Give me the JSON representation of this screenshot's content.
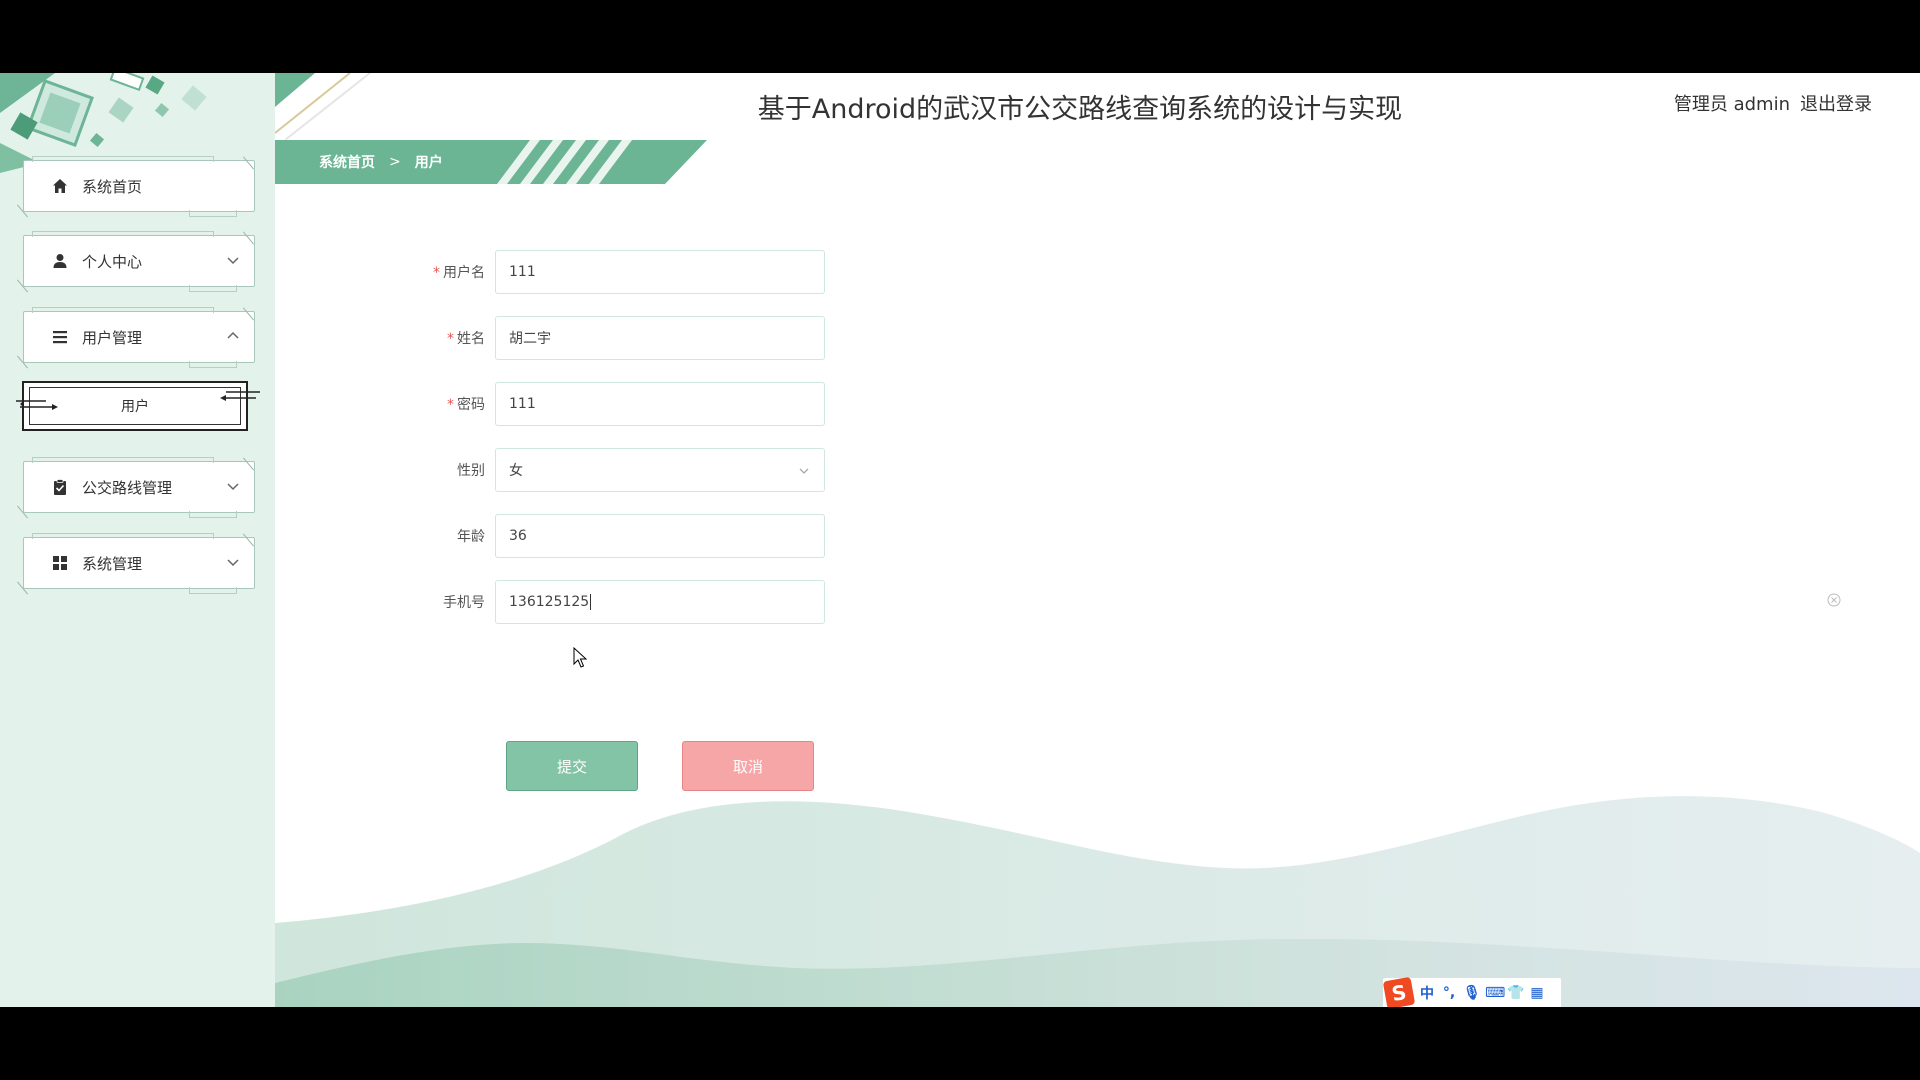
{
  "header": {
    "title": "基于Android的武汉市公交路线查询系统的设计与实现",
    "user_label": "管理员 admin",
    "logout_label": "退出登录"
  },
  "breadcrumb": {
    "home": "系统首页",
    "separator": ">",
    "current": "用户"
  },
  "sidebar": {
    "items": [
      {
        "label": "系统首页",
        "icon": "home-icon"
      },
      {
        "label": "个人中心",
        "icon": "person-icon",
        "arrow": "chevron-down-icon"
      },
      {
        "label": "用户管理",
        "icon": "list-icon",
        "arrow": "chevron-up-icon"
      },
      {
        "label": "公交路线管理",
        "icon": "clipboard-check-icon",
        "arrow": "chevron-down-icon"
      },
      {
        "label": "系统管理",
        "icon": "grid-icon",
        "arrow": "chevron-down-icon"
      }
    ],
    "submenu": {
      "label": "用户"
    }
  },
  "form": {
    "fields": [
      {
        "label": "用户名",
        "required": true,
        "value": "111"
      },
      {
        "label": "姓名",
        "required": true,
        "value": "胡二宇"
      },
      {
        "label": "密码",
        "required": true,
        "value": "111"
      },
      {
        "label": "性别",
        "required": false,
        "value": "女"
      },
      {
        "label": "年龄",
        "required": false,
        "value": "36"
      },
      {
        "label": "手机号",
        "required": false,
        "value": "136125125"
      }
    ],
    "required_mark": "*",
    "submit_label": "提交",
    "cancel_label": "取消"
  },
  "ime": {
    "items": [
      "中",
      "°,",
      "🎙",
      "⌨",
      "👕",
      "▦"
    ]
  },
  "colors": {
    "primary_green": "#6bb595",
    "sidebar_bg": "#e3f3ec",
    "cancel_pink": "#f7a6a8",
    "submit_green": "#84c4a6"
  }
}
